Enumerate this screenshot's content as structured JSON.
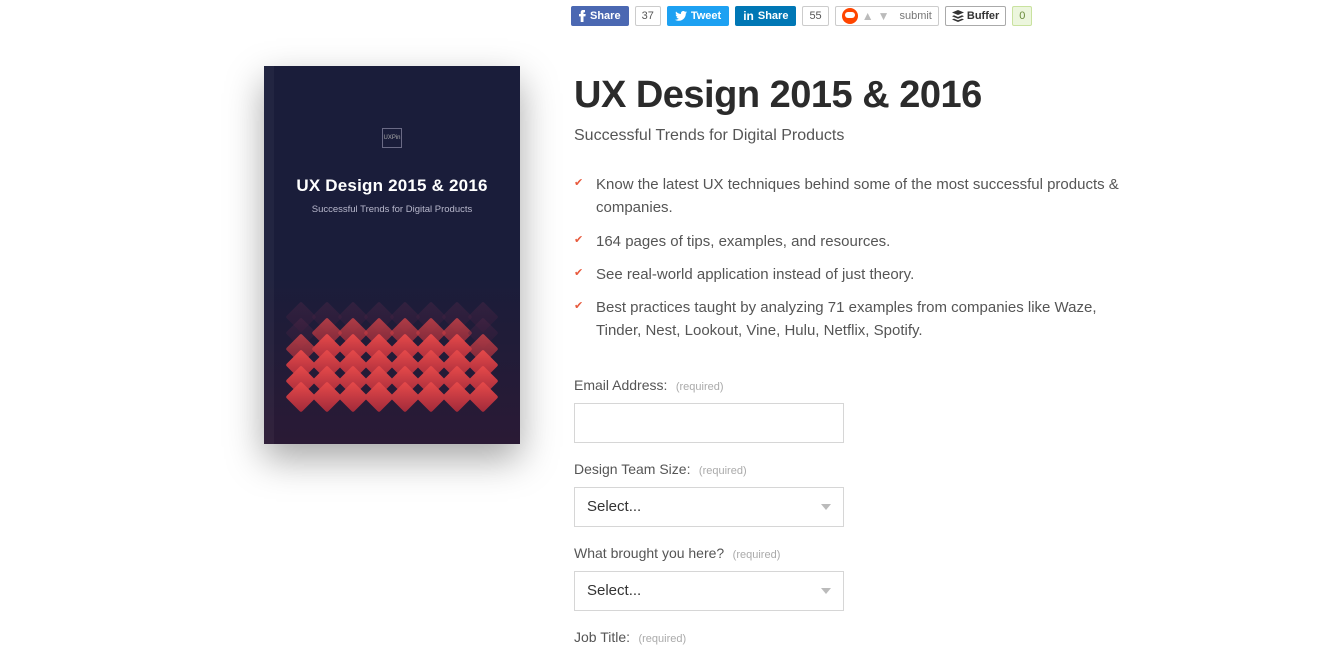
{
  "share": {
    "facebook": "Share",
    "facebook_count": "37",
    "twitter": "Tweet",
    "linkedin": "Share",
    "linkedin_count": "55",
    "reddit_submit": "submit",
    "buffer": "Buffer",
    "buffer_count": "0"
  },
  "book": {
    "logo": "UXPin",
    "title": "UX Design 2015 & 2016",
    "subtitle": "Successful Trends for Digital Products"
  },
  "page": {
    "title": "UX Design 2015 & 2016",
    "subtitle": "Successful Trends for Digital Products",
    "bullets": [
      "Know the latest UX techniques behind some of the most successful products & companies.",
      "164 pages of tips, examples, and resources.",
      "See real-world application instead of just theory.",
      "Best practices taught by analyzing 71 examples from companies like Waze, Tinder, Nest, Lookout, Vine, Hulu, Netflix, Spotify."
    ]
  },
  "form": {
    "required": "(required)",
    "select_placeholder": "Select...",
    "fields": {
      "email_label": "Email Address:",
      "team_label": "Design Team Size:",
      "reason_label": "What brought you here?",
      "job_label": "Job Title:"
    }
  }
}
